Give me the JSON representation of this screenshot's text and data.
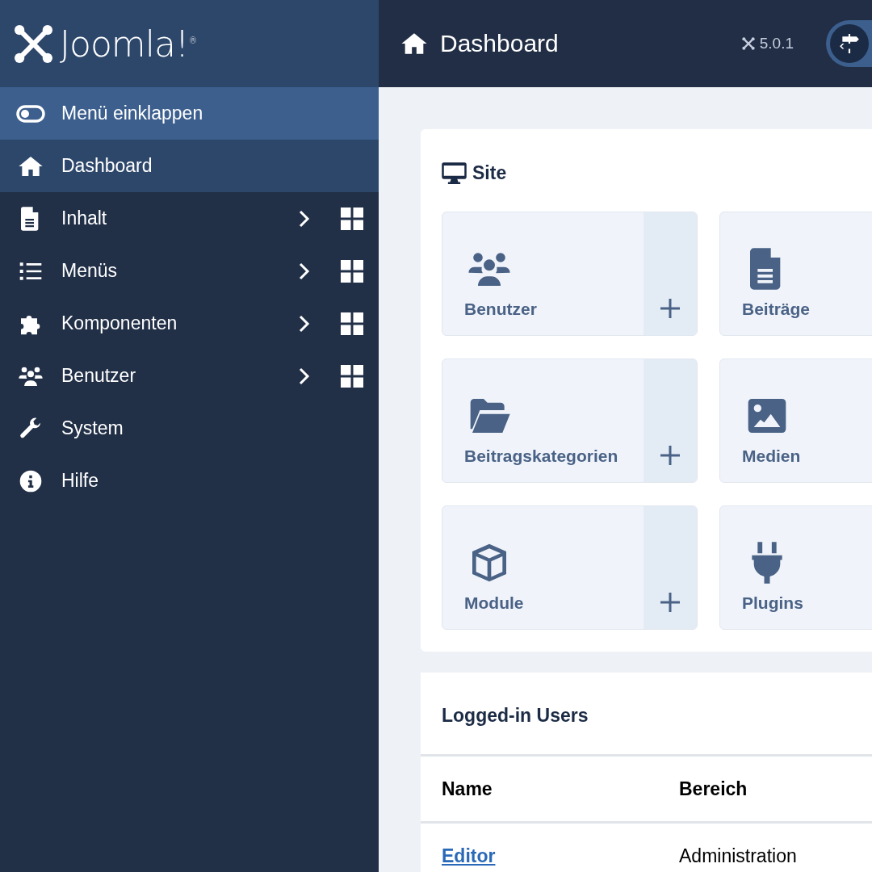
{
  "sidebar": {
    "logo": {
      "text": "Joomla!$^{®}$"
    },
    "toggle": {
      "label": "Menü einklappen"
    },
    "items": [
      {
        "label": "Dashboard",
        "selected": true,
        "submenu": false
      },
      {
        "label": "Inhalt",
        "selected": false,
        "submenu": true
      },
      {
        "label": "Menüs",
        "selected": false,
        "submenu": true
      },
      {
        "label": "Komponenten",
        "selected": false,
        "submenu": true
      },
      {
        "label": "Benutzer",
        "selected": false,
        "submenu": true
      },
      {
        "label": "System",
        "selected": false,
        "submenu": false
      },
      {
        "label": "Hilfe",
        "selected": false,
        "submenu": false
      }
    ]
  },
  "header": {
    "title": "Dashboard",
    "version": "5.0.1"
  },
  "site_card": {
    "title": "Site",
    "tiles": [
      {
        "label": "Benutzer",
        "add": true
      },
      {
        "label": "Beiträge"
      },
      {
        "label": "Beitragskategorien",
        "add": true
      },
      {
        "label": "Medien"
      },
      {
        "label": "Module",
        "add": true
      },
      {
        "label": "Plugins"
      }
    ]
  },
  "logged_in_users": {
    "title": "Logged-in Users",
    "columns": [
      "Name",
      "Bereich"
    ],
    "rows": [
      {
        "name": "Editor",
        "area": "Administration"
      }
    ]
  }
}
